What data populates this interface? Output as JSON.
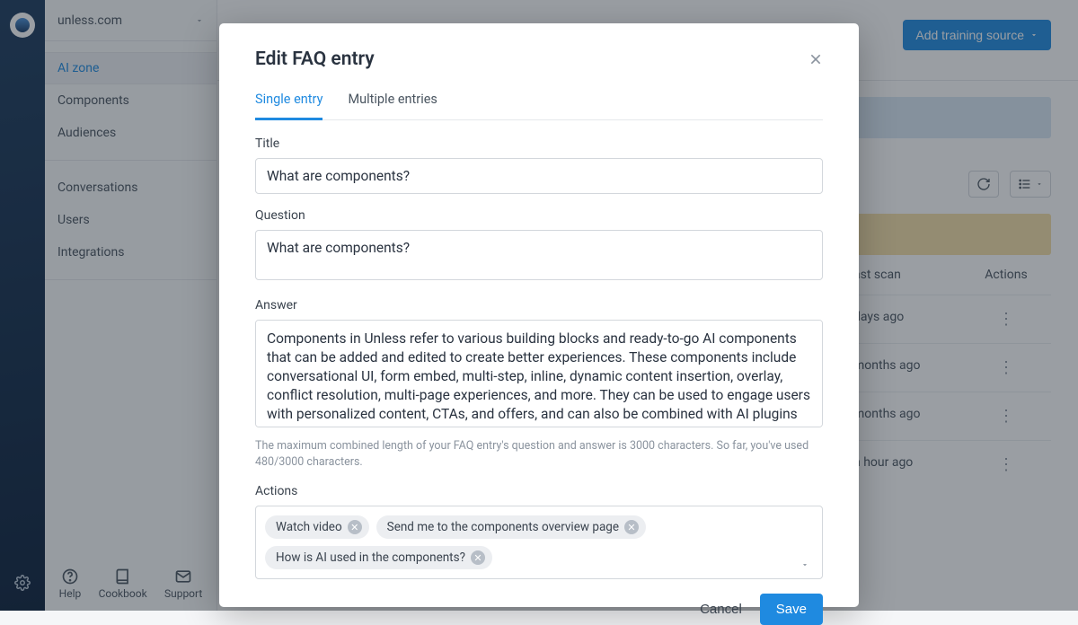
{
  "site": {
    "name": "unless.com"
  },
  "sidebar": {
    "items": [
      {
        "label": "AI zone"
      },
      {
        "label": "Components"
      },
      {
        "label": "Audiences"
      },
      {
        "label": "Conversations"
      },
      {
        "label": "Users"
      },
      {
        "label": "Integrations"
      }
    ],
    "footer": {
      "help": "Help",
      "cookbook": "Cookbook",
      "support": "Support"
    }
  },
  "main": {
    "add_training_btn": "Add training source",
    "table": {
      "th_scan": "ast scan",
      "th_actions": "Actions",
      "rows": [
        {
          "scan": "days ago"
        },
        {
          "scan": "months ago"
        },
        {
          "scan": "months ago"
        },
        {
          "scan": "n hour ago"
        }
      ]
    }
  },
  "modal": {
    "title": "Edit FAQ entry",
    "tabs": {
      "single": "Single entry",
      "multiple": "Multiple entries"
    },
    "labels": {
      "title": "Title",
      "question": "Question",
      "answer": "Answer",
      "actions": "Actions"
    },
    "values": {
      "title": "What are components?",
      "question": "What are components?",
      "answer": "Components in Unless refer to various building blocks and ready-to-go AI components that can be added and edited to create better experiences. These components include conversational UI, form embed, multi-step, inline, dynamic content insertion, overlay, conflict resolution, multi-page experiences, and more. They can be used to engage users with personalized content, CTAs, and offers, and can also be combined with AI plugins for customer support and sales."
    },
    "help": "The maximum combined length of your FAQ entry's question and answer is 3000 characters. So far, you've used 480/3000 characters.",
    "action_pills": [
      "Watch video",
      "Send me to the components overview page",
      "How is AI used in the components?"
    ],
    "buttons": {
      "cancel": "Cancel",
      "save": "Save"
    }
  }
}
